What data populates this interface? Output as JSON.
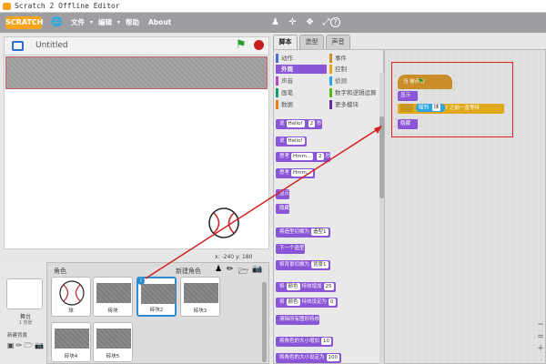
{
  "window": {
    "title": "Scratch 2 Offline Editor"
  },
  "menubar": {
    "logo": "SCRATCH",
    "items": [
      "文件",
      "编辑",
      "帮助",
      "About"
    ],
    "tools": [
      "person-stamp-icon",
      "expand-icon",
      "shrink-icon",
      "fullscreen-icon",
      "help-icon"
    ]
  },
  "stage": {
    "project_title": "Untitled",
    "coords": "x: -240  y: 180"
  },
  "sprites": {
    "header": "角色",
    "new_sprite": "新建角色",
    "stage_label": "舞台",
    "stage_sub": "1 背景",
    "new_backdrop": "新建背景",
    "items": [
      "球",
      "砖块",
      "砖块2",
      "砖块3",
      "砖块4",
      "砖块5"
    ]
  },
  "tabs": [
    "脚本",
    "造型",
    "声音"
  ],
  "categories": {
    "left": [
      "动作",
      "外观",
      "声音",
      "画笔",
      "数据"
    ],
    "right": [
      "事件",
      "控制",
      "侦测",
      "数字和逻辑运算",
      "更多模块"
    ]
  },
  "blocks": [
    {
      "pre": "说",
      "slot": "Hello!",
      "mid": "2",
      "post": "秒"
    },
    {
      "pre": "说",
      "slot": "Hello!",
      "mid": "",
      "post": ""
    },
    {
      "pre": "思考",
      "slot": "Hmm...",
      "mid": "2",
      "post": "秒"
    },
    {
      "pre": "思考",
      "slot": "Hmm...",
      "mid": "",
      "post": ""
    },
    {
      "pre": "显示",
      "slot": "",
      "mid": "",
      "post": ""
    },
    {
      "pre": "隐藏",
      "slot": "",
      "mid": "",
      "post": ""
    },
    {
      "pre": "将造型切换为",
      "slot": "造型1",
      "mid": "",
      "post": ""
    },
    {
      "pre": "下一个造型",
      "slot": "",
      "mid": "",
      "post": ""
    },
    {
      "pre": "将背景切换为",
      "slot": "背景1",
      "mid": "",
      "post": ""
    },
    {
      "pre": "将",
      "slot": "颜色",
      "mid": "25",
      "post": "特效增加"
    },
    {
      "pre": "将",
      "slot": "颜色",
      "mid": "0",
      "post": "特效设定为"
    },
    {
      "pre": "清除所有图形特效",
      "slot": "",
      "mid": "",
      "post": ""
    },
    {
      "pre": "将角色的大小增加",
      "slot": "",
      "mid": "10",
      "post": ""
    },
    {
      "pre": "将角色的大小设定为",
      "slot": "",
      "mid": "100",
      "post": ""
    }
  ],
  "script": {
    "hat": "当 被点击",
    "show": "显示",
    "touch_pre": "碰到",
    "touch_slot": "球",
    "touch_post": "? 之前一直等待",
    "hide": "隐藏"
  },
  "colors": {
    "looks": "#8a55d7",
    "events": "#c98d2a",
    "control": "#e1a91a",
    "sensing": "#2ca5e2",
    "accent": "#d22222"
  }
}
